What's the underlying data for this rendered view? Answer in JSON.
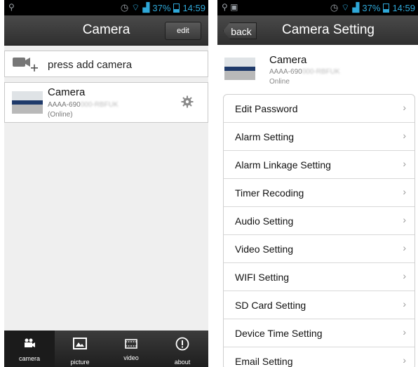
{
  "left": {
    "status_bar": {
      "time": "14:59",
      "battery": "37%"
    },
    "title": "Camera",
    "edit_label": "edit",
    "add_camera_label": "press add camera",
    "camera": {
      "name": "Camera",
      "uid_prefix": "AAAA-690",
      "status": "(Online)"
    },
    "tabs": [
      {
        "label": "camera",
        "icon": "camera-icon",
        "active": true
      },
      {
        "label": "picture",
        "icon": "picture-icon",
        "active": false
      },
      {
        "label": "video",
        "icon": "video-icon",
        "active": false
      },
      {
        "label": "about",
        "icon": "info-icon",
        "active": false
      }
    ]
  },
  "right": {
    "status_bar": {
      "time": "14:59",
      "battery": "37%"
    },
    "back_label": "back",
    "title": "Camera Setting",
    "device": {
      "name": "Camera",
      "uid_prefix": "AAAA-690",
      "status": "Online"
    },
    "settings": [
      "Edit Password",
      "Alarm Setting",
      "Alarm Linkage Setting",
      "Timer Recoding",
      "Audio Setting",
      "Video Setting",
      "WIFI Setting",
      "SD Card Setting",
      "Device Time Setting",
      "Email Setting"
    ]
  },
  "colors": {
    "accent": "#2fa8d8",
    "title_bar": "#3a3a3a",
    "tab_bar": "#1e1e1e"
  }
}
